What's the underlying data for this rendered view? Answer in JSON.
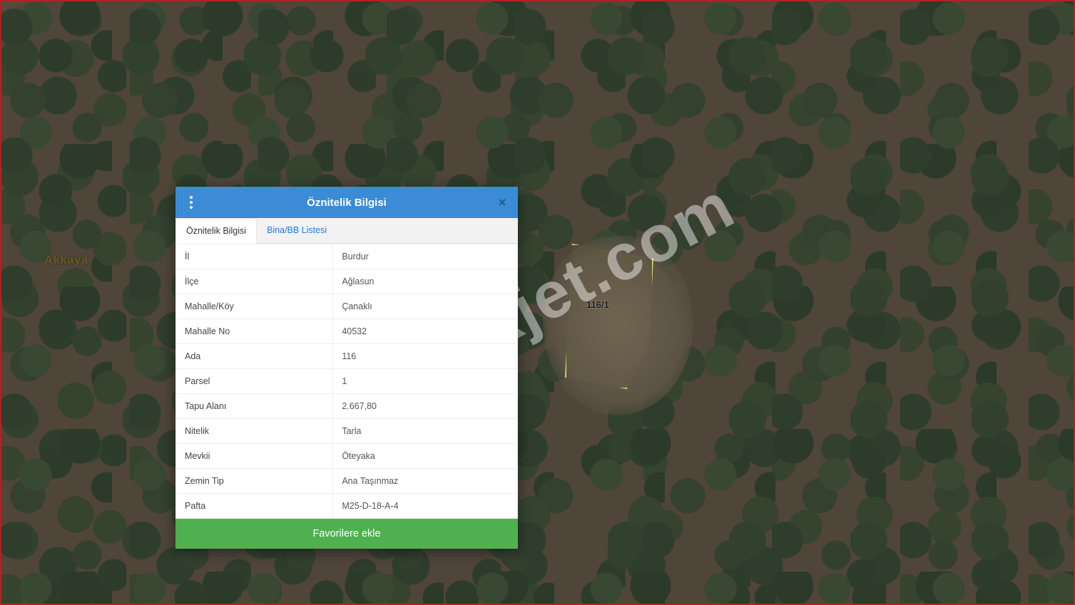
{
  "panel": {
    "title": "Öznitelik Bilgisi",
    "tabs": {
      "active": "Öznitelik Bilgisi",
      "other": "Bina/BB Listesi"
    },
    "rows": [
      {
        "k": "İl",
        "v": "Burdur"
      },
      {
        "k": "İlçe",
        "v": "Ağlasun"
      },
      {
        "k": "Mahalle/Köy",
        "v": "Çanaklı"
      },
      {
        "k": "Mahalle No",
        "v": "40532"
      },
      {
        "k": "Ada",
        "v": "116"
      },
      {
        "k": "Parsel",
        "v": "1"
      },
      {
        "k": "Tapu Alanı",
        "v": "2.667,80"
      },
      {
        "k": "Nitelik",
        "v": "Tarla"
      },
      {
        "k": "Mevkii",
        "v": "Öteyaka"
      },
      {
        "k": "Zemin Tip",
        "v": "Ana Taşınmaz"
      },
      {
        "k": "Pafta",
        "v": "M25-D-18-A-4"
      }
    ],
    "fav_label": "Favorilere ekle"
  },
  "map": {
    "place_label": "Akkaya",
    "parcel_label": "116/1",
    "watermark": "emlakjet.com"
  }
}
